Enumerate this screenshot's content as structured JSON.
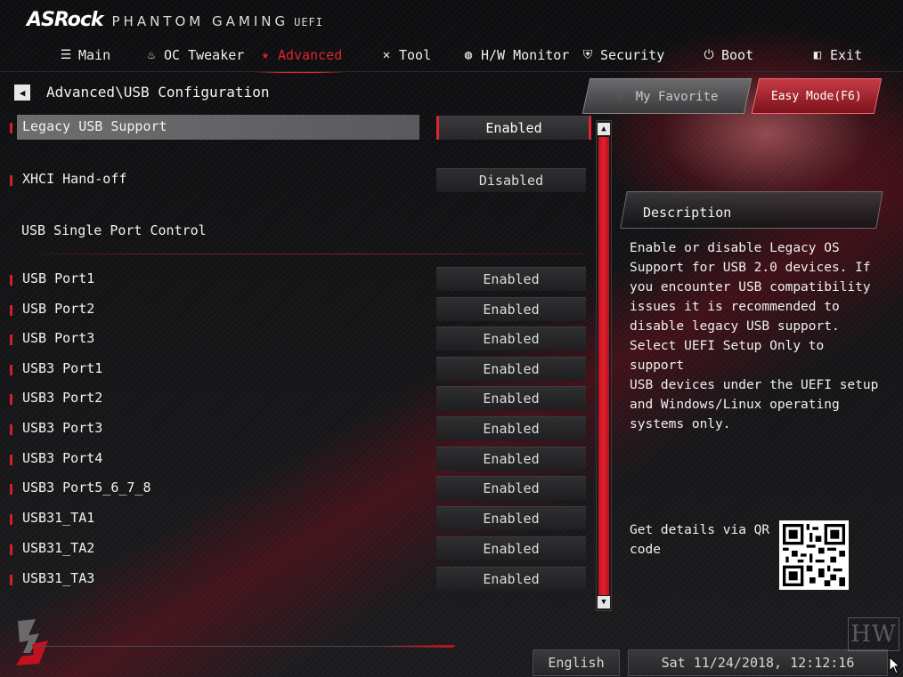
{
  "brand": {
    "logo": "ASRock",
    "product": "PHANTOM GAMING",
    "uefi": "UEFI"
  },
  "nav": {
    "tabs": [
      {
        "label": "Main",
        "icon": "list-icon"
      },
      {
        "label": "OC Tweaker",
        "icon": "flame-icon"
      },
      {
        "label": "Advanced",
        "icon": "star-icon",
        "active": true
      },
      {
        "label": "Tool",
        "icon": "tools-icon"
      },
      {
        "label": "H/W Monitor",
        "icon": "monitor-icon"
      },
      {
        "label": "Security",
        "icon": "shield-icon"
      },
      {
        "label": "Boot",
        "icon": "power-icon"
      },
      {
        "label": "Exit",
        "icon": "exit-icon"
      }
    ]
  },
  "breadcrumb": "Advanced\\USB Configuration",
  "buttons": {
    "favorite": "My Favorite",
    "easy_mode": "Easy Mode(F6)"
  },
  "settings": [
    {
      "label": "Legacy USB Support",
      "value": "Enabled",
      "selected": true
    },
    {
      "label": "XHCI Hand-off",
      "value": "Disabled"
    }
  ],
  "section": {
    "title": "USB Single Port Control"
  },
  "ports": [
    {
      "label": "USB Port1",
      "value": "Enabled"
    },
    {
      "label": "USB Port2",
      "value": "Enabled"
    },
    {
      "label": "USB Port3",
      "value": "Enabled"
    },
    {
      "label": "USB3 Port1",
      "value": "Enabled"
    },
    {
      "label": "USB3 Port2",
      "value": "Enabled"
    },
    {
      "label": "USB3 Port3",
      "value": "Enabled"
    },
    {
      "label": "USB3 Port4",
      "value": "Enabled"
    },
    {
      "label": "USB3 Port5_6_7_8",
      "value": "Enabled"
    },
    {
      "label": "USB31_TA1",
      "value": "Enabled"
    },
    {
      "label": "USB31_TA2",
      "value": "Enabled"
    },
    {
      "label": "USB31_TA3",
      "value": "Enabled"
    }
  ],
  "description": {
    "title": "Description",
    "body": "Enable or disable Legacy OS\nSupport for USB 2.0 devices. If\nyou encounter USB compatibility\nissues it is recommended to\ndisable legacy USB support.\nSelect UEFI Setup Only to support\nUSB devices under the UEFI setup\nand Windows/Linux operating\nsystems only."
  },
  "qr": {
    "text": "Get details via QR\ncode"
  },
  "footer": {
    "language": "English",
    "datetime": "Sat 11/24/2018, 12:12:16",
    "watermark": "HW"
  },
  "colors": {
    "accent": "#e3212f",
    "panel": "#2a2a2c"
  }
}
